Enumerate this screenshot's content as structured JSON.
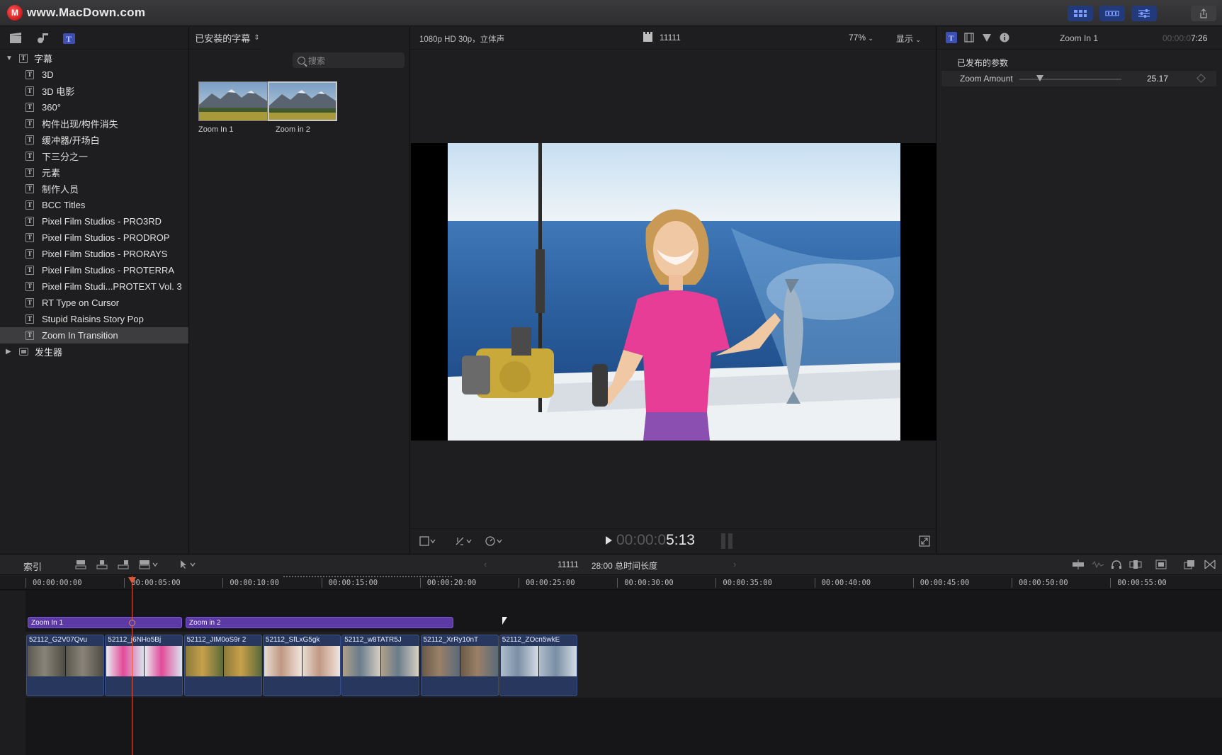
{
  "watermark": {
    "text": "www.MacDown.com",
    "logo_letter": "M"
  },
  "sidebar": {
    "items": [
      {
        "label": "字幕",
        "type": "folder-open",
        "indent": 0
      },
      {
        "label": "3D"
      },
      {
        "label": "3D 电影"
      },
      {
        "label": "360°"
      },
      {
        "label": "构件出现/构件消失"
      },
      {
        "label": "缓冲器/开场白"
      },
      {
        "label": "下三分之一"
      },
      {
        "label": "元素"
      },
      {
        "label": "制作人员"
      },
      {
        "label": "BCC Titles"
      },
      {
        "label": "Pixel Film Studios - PRO3RD"
      },
      {
        "label": "Pixel Film Studios - PRODROP"
      },
      {
        "label": "Pixel Film Studios - PRORAYS"
      },
      {
        "label": "Pixel Film Studios - PROTERRA"
      },
      {
        "label": "Pixel Film Studi...PROTEXT Vol. 3"
      },
      {
        "label": "RT Type on Cursor"
      },
      {
        "label": "Stupid Raisins Story Pop"
      },
      {
        "label": "Zoom In Transition",
        "selected": true
      },
      {
        "label": "发生器",
        "type": "folder-closed"
      }
    ]
  },
  "browser": {
    "header": "已安装的字幕",
    "search_placeholder": "搜索",
    "thumbnails": [
      {
        "label": "Zoom In 1"
      },
      {
        "label": "Zoom in 2"
      }
    ]
  },
  "viewer": {
    "format": "1080p HD 30p，立体声",
    "clip_name": "11111",
    "zoom": "77%",
    "display": "显示",
    "timecode_dim": "00:00:0",
    "timecode_bright": "5:13"
  },
  "inspector": {
    "title": "Zoom In 1",
    "duration_dim": "00:00:0",
    "duration_bright": "7:26",
    "section": "已发布的参数",
    "param": {
      "label": "Zoom Amount",
      "value": "25.17",
      "slider_fraction": 0.2
    }
  },
  "timeline_toolbar": {
    "index_label": "索引",
    "project_name": "11111",
    "total_duration": "28:00 总时间长度"
  },
  "timeline": {
    "ruler": [
      "00:00:00:00",
      "00:00:05:00",
      "00:00:10:00",
      "00:00:15:00",
      "00:00:20:00",
      "00:00:25:00",
      "00:00:30:00",
      "00:00:35:00",
      "00:00:40:00",
      "00:00:45:00",
      "00:00:50:00",
      "00:00:55:00"
    ],
    "title_clips": [
      {
        "name": "Zoom In 1"
      },
      {
        "name": "Zoom in 2"
      }
    ],
    "video_clips": [
      {
        "name": "52112_G2V07Qvu"
      },
      {
        "name": "52112_j6NHo5Bj"
      },
      {
        "name": "52112_JIM0oS9r 2"
      },
      {
        "name": "52112_SfLxG5gk"
      },
      {
        "name": "52112_w8TATR5J"
      },
      {
        "name": "52112_XrRy10nT"
      },
      {
        "name": "52112_ZOcn5wkE"
      }
    ]
  },
  "colors": {
    "accent": "#5b3aa6",
    "playhead": "#e05a3a",
    "clip_blue": "#27375e",
    "toolbar_blue": "#233a7a"
  }
}
